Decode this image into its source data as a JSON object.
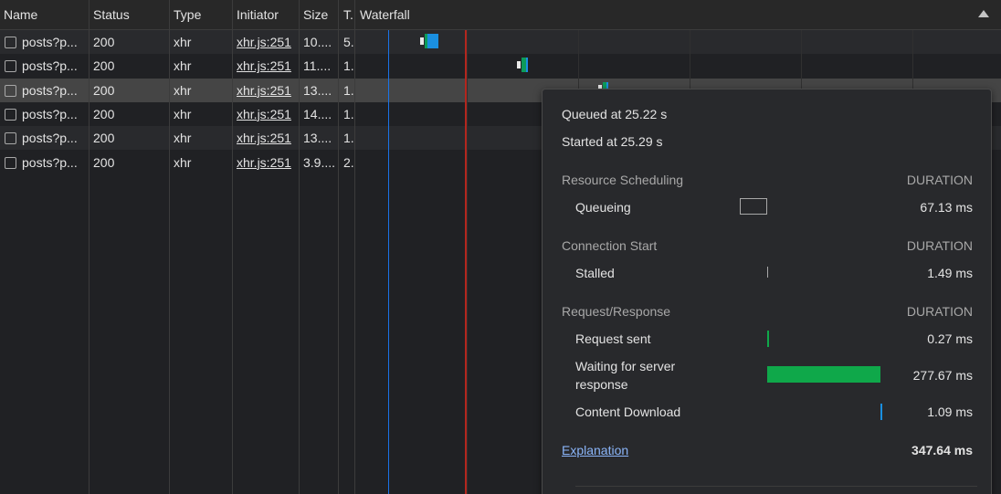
{
  "columns": {
    "name": "Name",
    "status": "Status",
    "type": "Type",
    "initiator": "Initiator",
    "size": "Size",
    "time": "T.",
    "waterfall": "Waterfall"
  },
  "rows": [
    {
      "name": "posts?p...",
      "status": "200",
      "type": "xhr",
      "initiator": "xhr.js:251",
      "size": "10....",
      "time": "5."
    },
    {
      "name": "posts?p...",
      "status": "200",
      "type": "xhr",
      "initiator": "xhr.js:251",
      "size": "11....",
      "time": "1."
    },
    {
      "name": "posts?p...",
      "status": "200",
      "type": "xhr",
      "initiator": "xhr.js:251",
      "size": "13....",
      "time": "1."
    },
    {
      "name": "posts?p...",
      "status": "200",
      "type": "xhr",
      "initiator": "xhr.js:251",
      "size": "14....",
      "time": "1."
    },
    {
      "name": "posts?p...",
      "status": "200",
      "type": "xhr",
      "initiator": "xhr.js:251",
      "size": "13....",
      "time": "1."
    },
    {
      "name": "posts?p...",
      "status": "200",
      "type": "xhr",
      "initiator": "xhr.js:251",
      "size": "3.9....",
      "time": "2."
    }
  ],
  "timing": {
    "queued_at": "Queued at 25.22 s",
    "started_at": "Started at 25.29 s",
    "sections": {
      "scheduling": "Resource Scheduling",
      "connection": "Connection Start",
      "request": "Request/Response"
    },
    "duration_header": "DURATION",
    "phases": {
      "queueing": {
        "label": "Queueing",
        "value": "67.13 ms"
      },
      "stalled": {
        "label": "Stalled",
        "value": "1.49 ms"
      },
      "request_sent": {
        "label": "Request sent",
        "value": "0.27 ms"
      },
      "waiting": {
        "label_line1": "Waiting for server",
        "label_line2": "response",
        "value": "277.67 ms"
      },
      "download": {
        "label": "Content Download",
        "value": "1.09 ms"
      }
    },
    "explanation": "Explanation",
    "total": "347.64 ms"
  },
  "colors": {
    "waiting": "#0fa84a",
    "download": "#1a8fe0",
    "dom_content_loaded": "#1a73e8",
    "load": "#b3261e"
  }
}
